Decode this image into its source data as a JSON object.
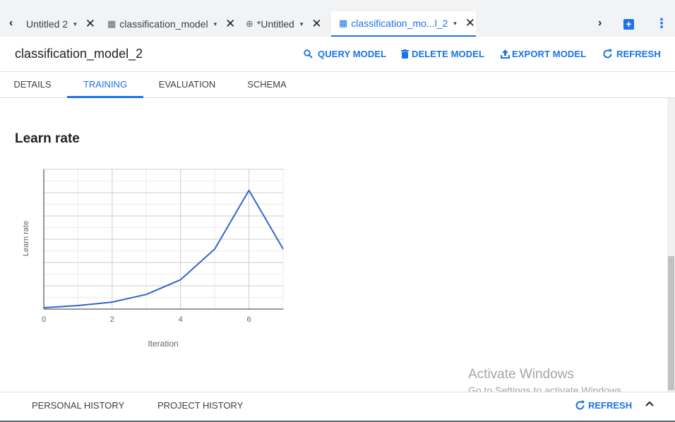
{
  "tabs": [
    {
      "label": "Untitled 2",
      "icon": "none",
      "active": false
    },
    {
      "label": "classification_model",
      "icon": "table-icon",
      "active": false
    },
    {
      "label": "*Untitled",
      "icon": "query-icon",
      "active": false
    },
    {
      "label": "classification_mo...l_2",
      "icon": "table-icon",
      "active": true
    }
  ],
  "tab_glyphs": {
    "back": "‹",
    "forward": "›",
    "caret": "▾",
    "close": "✕",
    "add": "+",
    "more": "⋮",
    "table": "▦",
    "query": "⊕"
  },
  "header": {
    "title": "classification_model_2",
    "actions": {
      "query": "QUERY MODEL",
      "delete": "DELETE MODEL",
      "export": "EXPORT MODEL",
      "refresh": "REFRESH"
    }
  },
  "subtabs": {
    "details": "DETAILS",
    "training": "TRAINING",
    "evaluation": "EVALUATION",
    "schema": "SCHEMA",
    "active": "TRAINING"
  },
  "section_title": "Learn rate",
  "chart_data": {
    "type": "line",
    "title": "",
    "xlabel": "Iteration",
    "ylabel": "Learn rate",
    "x_ticks": [
      "0",
      "2",
      "4",
      "6"
    ],
    "xlim": [
      0,
      7
    ],
    "ylim": [
      0,
      1
    ],
    "y_tick_labels_shown": false,
    "grid": true,
    "series": [
      {
        "x": [
          0,
          1,
          2,
          3,
          4,
          5,
          6,
          7
        ],
        "values": [
          0.01,
          0.025,
          0.05,
          0.105,
          0.21,
          0.43,
          0.85,
          0.43
        ]
      }
    ],
    "line_color": "#3366cc"
  },
  "watermark": {
    "title": "Activate Windows",
    "subtitle": "Go to Settings to activate Windows."
  },
  "bottom": {
    "personal_history": "PERSONAL HISTORY",
    "project_history": "PROJECT HISTORY",
    "refresh": "REFRESH"
  },
  "colors": {
    "accent": "#1a73e8",
    "tabbar_bg": "#f1f3f4",
    "text": "#202124"
  }
}
